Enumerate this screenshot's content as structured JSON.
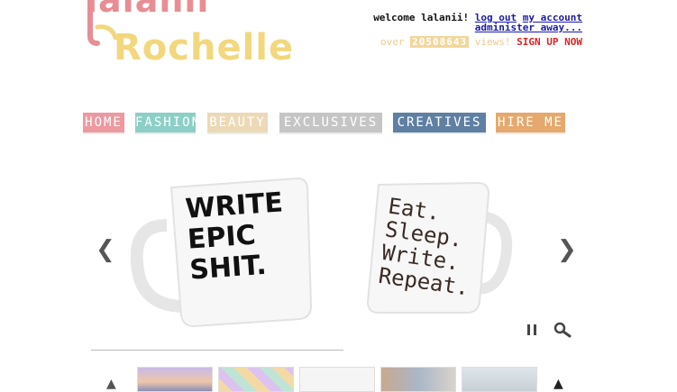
{
  "logo": {
    "line1": "lalanii",
    "line2": "Rochelle"
  },
  "account": {
    "welcome": "welcome lalanii!",
    "logout": "log out",
    "my_account": "my account",
    "administer": "administer away...",
    "views_prefix": "over",
    "views_count": "20508643",
    "views_suffix": "views!",
    "signup": "SIGN UP NOW"
  },
  "nav": [
    {
      "label": "HOME",
      "color": "#ec9aa0"
    },
    {
      "label": "FASHION",
      "color": "#8ccfc6"
    },
    {
      "label": "BEAUTY",
      "color": "#ecd9b6"
    },
    {
      "label": "EXCLUSIVES",
      "color": "#c5c5c5"
    },
    {
      "label": "CREATIVES",
      "color": "#5f7fa3"
    },
    {
      "label": "HIRE ME",
      "color": "#e6a86c"
    }
  ],
  "slider": {
    "mug1": [
      "WRITE",
      "EPIC",
      "SHIT."
    ],
    "mug2": [
      "Eat.",
      "Sleep.",
      "Write.",
      "Repeat."
    ],
    "prev_icon": "chevron-left-icon",
    "next_icon": "chevron-right-icon",
    "pause_icon": "pause-icon",
    "zoom_icon": "magnifier-icon"
  }
}
